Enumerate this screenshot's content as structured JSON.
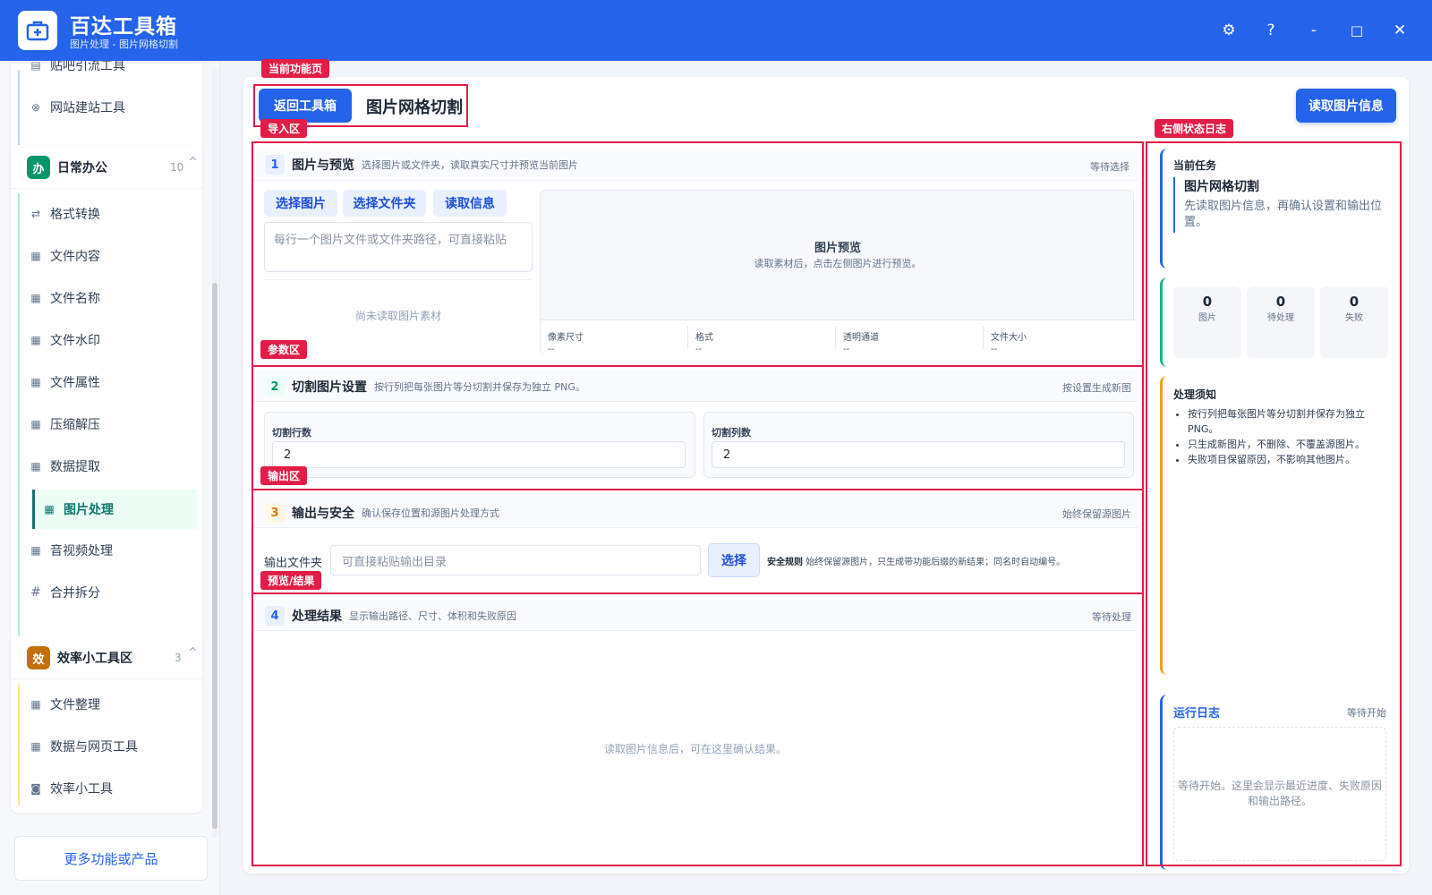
{
  "app": {
    "title": "百达工具箱",
    "subtitle": "图片处理 - 图片网格切割"
  },
  "window": {
    "settings": "⚙",
    "help": "?",
    "minimize": "-",
    "maximize": "□",
    "close": "✕"
  },
  "sidebar": {
    "top_items": [
      {
        "label": "贴吧引流工具"
      },
      {
        "label": "网站建站工具"
      }
    ],
    "group_office": {
      "badge": "办",
      "title": "日常办公",
      "count": "10",
      "chevron": "^",
      "items": [
        {
          "icon": "⇄",
          "label": "格式转换"
        },
        {
          "icon": "▦",
          "label": "文件内容"
        },
        {
          "icon": "▦",
          "label": "文件名称"
        },
        {
          "icon": "▦",
          "label": "文件水印"
        },
        {
          "icon": "▦",
          "label": "文件属性"
        },
        {
          "icon": "▦",
          "label": "压缩解压"
        },
        {
          "icon": "▦",
          "label": "数据提取"
        },
        {
          "icon": "▦",
          "label": "图片处理"
        },
        {
          "icon": "▦",
          "label": "音视频处理"
        },
        {
          "icon": "#",
          "label": "合并拆分"
        }
      ]
    },
    "group_efficiency": {
      "badge": "效",
      "title": "效率小工具区",
      "count": "3",
      "chevron": "^",
      "items": [
        {
          "icon": "▦",
          "label": "文件整理"
        },
        {
          "icon": "▦",
          "label": "数据与网页工具"
        },
        {
          "icon": "◙",
          "label": "效率小工具"
        }
      ]
    },
    "more": "更多功能或产品"
  },
  "header": {
    "back": "返回工具箱",
    "title": "图片网格切割",
    "read_info": "读取图片信息"
  },
  "annotations": {
    "current_page": "当前功能页",
    "import": "导入区",
    "params": "参数区",
    "output": "输出区",
    "preview_result": "预览/结果",
    "right_log": "右侧状态日志"
  },
  "section1": {
    "num": "1",
    "title": "图片与预览",
    "desc": "选择图片或文件夹，读取真实尺寸并预览当前图片",
    "status": "等待选择",
    "btn_select_image": "选择图片",
    "btn_select_folder": "选择文件夹",
    "btn_read_info": "读取信息",
    "path_placeholder": "每行一个图片文件或文件夹路径，可直接粘贴",
    "empty": "尚未读取图片素材",
    "preview_title": "图片预览",
    "preview_hint": "读取素材后，点击左侧图片进行预览。",
    "info": [
      {
        "label": "像素尺寸",
        "value": "--"
      },
      {
        "label": "格式",
        "value": "--"
      },
      {
        "label": "透明通道",
        "value": "--"
      },
      {
        "label": "文件大小",
        "value": "--"
      }
    ]
  },
  "section2": {
    "num": "2",
    "title": "切割图片设置",
    "desc": "按行列把每张图片等分切割并保存为独立 PNG。",
    "status": "按设置生成新图",
    "rows_label": "切割行数",
    "rows_value": "2",
    "cols_label": "切割列数",
    "cols_value": "2"
  },
  "section3": {
    "num": "3",
    "title": "输出与安全",
    "desc": "确认保存位置和源图片处理方式",
    "status": "始终保留源图片",
    "folder_label": "输出文件夹",
    "folder_placeholder": "可直接粘贴输出目录",
    "choose": "选择",
    "rule_label": "安全规则",
    "rule_text": "始终保留源图片，只生成带功能后缀的新结果；同名时自动编号。"
  },
  "section4": {
    "num": "4",
    "title": "处理结果",
    "desc": "显示输出路径、尺寸、体积和失败原因",
    "status": "等待处理",
    "empty": "读取图片信息后，可在这里确认结果。"
  },
  "right": {
    "task_label": "当前任务",
    "task_title": "图片网格切割",
    "task_desc": "先读取图片信息，再确认设置和输出位置。",
    "stats": [
      {
        "value": "0",
        "label": "图片"
      },
      {
        "value": "0",
        "label": "待处理"
      },
      {
        "value": "0",
        "label": "失败"
      }
    ],
    "notes_title": "处理须知",
    "notes": [
      "按行列把每张图片等分切割并保存为独立 PNG。",
      "只生成新图片，不删除、不覆盖源图片。",
      "失败项目保留原因，不影响其他图片。"
    ],
    "log_title": "运行日志",
    "log_status": "等待开始",
    "log_empty": "等待开始。这里会显示最近进度、失败原因和输出路径。"
  },
  "colors": {
    "accent": "#2563eb",
    "active_green": "#0f766e",
    "annotation_red": "#e11d48"
  }
}
